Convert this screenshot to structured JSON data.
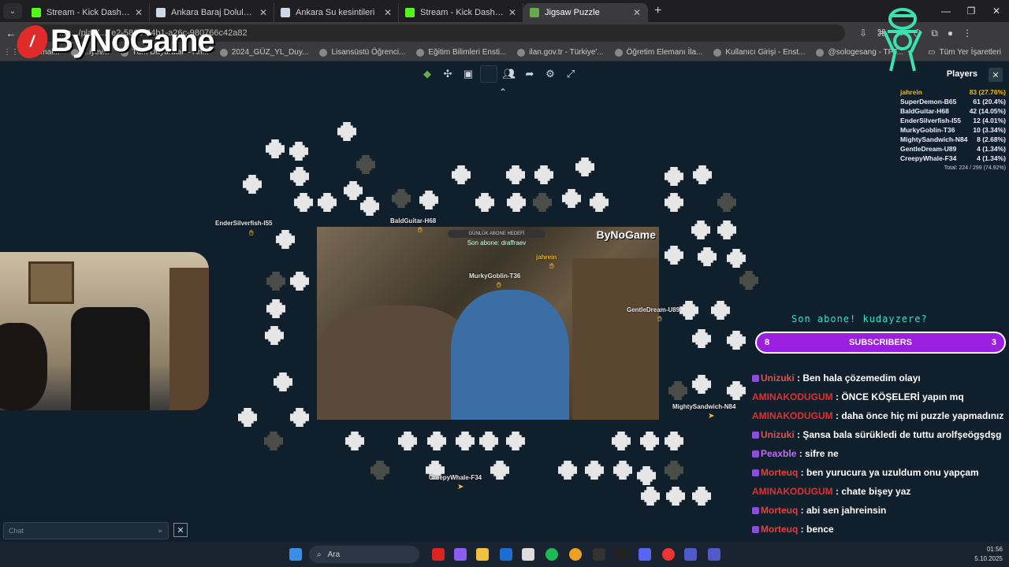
{
  "browser": {
    "tabs": [
      {
        "label": "Stream - Kick Dashboard",
        "icon": "kick-icon",
        "color": "#53fc18"
      },
      {
        "label": "Ankara Baraj Doluluk Oranları",
        "icon": "page-icon",
        "color": "#cfd8e6"
      },
      {
        "label": "Ankara Su kesintileri",
        "icon": "page-icon",
        "color": "#cfd8e6"
      },
      {
        "label": "Stream - Kick Dashboard",
        "icon": "kick-icon",
        "color": "#53fc18"
      },
      {
        "label": "Jigsaw Puzzle",
        "icon": "puzzle-icon",
        "color": "#6aa84f"
      }
    ],
    "url": "...ta.../play/...5e2-5868-44b1-a26c-980766c42a82",
    "bookmarks": [
      "...mal...",
      "...iyev...",
      "Tüm Duyurular – An...",
      "2024_GÜZ_YL_Duy...",
      "Lisansüstü Öğrenci...",
      "Eğitim Bilimleri Ensti...",
      "ilan.gov.tr - Türkiye'...",
      "Öğretim Elemanı İla...",
      "Kullanıcı Girişi - Enst...",
      "@sologesang - TFT..."
    ],
    "bookmarks_right": "Tüm Yer İşaretleri"
  },
  "logo": {
    "text": "ByNoGame"
  },
  "puzzle": {
    "cursors": [
      {
        "name": "EnderSilverfish-I55"
      },
      {
        "name": "BaldGuitar-H68"
      },
      {
        "name": "MurkyGoblin-T36"
      },
      {
        "name": "jahrein"
      },
      {
        "name": "GentleDream-U89"
      },
      {
        "name": "MightySandwich-N84"
      },
      {
        "name": "CreepyWhale-F34"
      }
    ],
    "board_brand": "ByNoGame",
    "board_banner": "GÜNLÜK ABONE HEDEFİ",
    "board_banner2": "Son abone: draffraev"
  },
  "players": {
    "title": "Players",
    "list": [
      {
        "name": "jahrein",
        "score": "83 (27.76%)"
      },
      {
        "name": "SuperDemon-B65",
        "score": "61 (20.4%)"
      },
      {
        "name": "BaldGuitar-H68",
        "score": "42 (14.05%)"
      },
      {
        "name": "EnderSilverfish-I55",
        "score": "12 (4.01%)"
      },
      {
        "name": "MurkyGoblin-T36",
        "score": "10 (3.34%)"
      },
      {
        "name": "MightySandwich-N84",
        "score": "8 (2.68%)"
      },
      {
        "name": "GentleDream-U89",
        "score": "4 (1.34%)"
      },
      {
        "name": "CreepyWhale-F34",
        "score": "4 (1.34%)"
      }
    ],
    "total": "Total: 224 / 299 (74.92%)"
  },
  "overlay": {
    "last_sub": "Son abone! kudayzere?",
    "sub_left": "8",
    "sub_label": "SUBSCRIBERS",
    "sub_right": "3",
    "chat": [
      {
        "user": "Unizuki",
        "color": "#e05050",
        "text": ": Ben hala çözemedim olayı"
      },
      {
        "user": "AMINAKODUGUM",
        "color": "#e03030",
        "text": ": ÖNCE KÖŞELERİ yapın mq"
      },
      {
        "user": "AMINAKODUGUM",
        "color": "#e03030",
        "text": ": daha önce hiç mi puzzle yapmadınız"
      },
      {
        "user": "Unizuki",
        "color": "#e05050",
        "text": ": Şansa bala sürükledi de tuttu arolfşeögşdşg"
      },
      {
        "user": "Peaxble",
        "color": "#c070f0",
        "text": ": sifre ne"
      },
      {
        "user": "Morteuq",
        "color": "#e04040",
        "text": ": ben yurucura ya uzuldum onu yapçam"
      },
      {
        "user": "AMINAKODUGUM",
        "color": "#e03030",
        "text": ": chate bişey yaz"
      },
      {
        "user": "Morteuq",
        "color": "#e04040",
        "text": ": abi sen jahreinsin"
      },
      {
        "user": "Morteuq",
        "color": "#e04040",
        "text": ": bence"
      }
    ]
  },
  "chat_input": {
    "placeholder": "Chat"
  },
  "taskbar": {
    "search": "Ara",
    "time": "01:56",
    "date": "5.10.2025"
  }
}
